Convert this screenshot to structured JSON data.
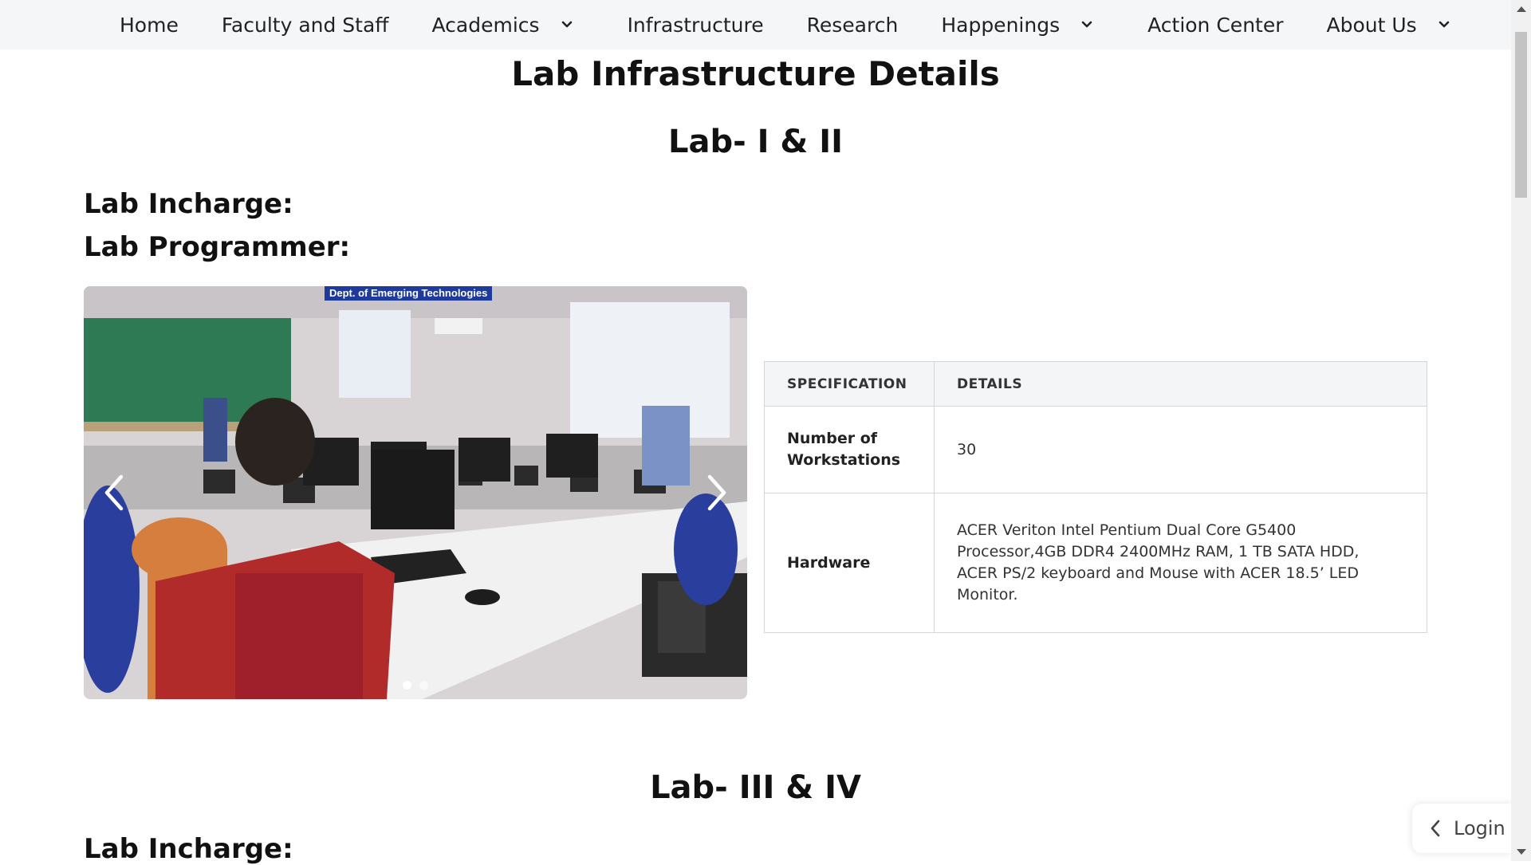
{
  "nav": {
    "items": [
      {
        "label": "Home"
      },
      {
        "label": "Faculty and Staff"
      },
      {
        "label": "Academics"
      },
      {
        "label": "Infrastructure"
      },
      {
        "label": "Research"
      },
      {
        "label": "Happenings"
      },
      {
        "label": "Action Center"
      },
      {
        "label": "About Us"
      }
    ],
    "dropdown_icon": "chevron-down-icon"
  },
  "page_title": "Lab Infrastructure Details",
  "labs": [
    {
      "title": "Lab- I & II",
      "incharge_label": "Lab Incharge:",
      "programmer_label": "Lab Programmer:",
      "carousel": {
        "banner_text": "Dept. of Emerging Technologies",
        "slide_count": 2,
        "active_slide": 1,
        "prev_icon": "chevron-left-icon",
        "next_icon": "chevron-right-icon"
      },
      "table": {
        "headers": [
          "SPECIFICATION",
          "DETAILS"
        ],
        "rows": [
          {
            "spec": "Number of Workstations",
            "details": "30"
          },
          {
            "spec": "Hardware",
            "details": "ACER Veriton Intel Pentium Dual Core G5400 Processor,4GB DDR4 2400MHz RAM, 1 TB SATA HDD, ACER PS/2 keyboard and Mouse with ACER 18.5’ LED Monitor."
          }
        ]
      }
    },
    {
      "title": "Lab- III & IV",
      "incharge_label": "Lab Incharge:"
    }
  ],
  "login": {
    "label": "Login",
    "icon": "chevron-left-icon"
  },
  "colors": {
    "nav_bg": "#f5f6f8",
    "table_header_bg": "#f4f5f6",
    "banner_blue": "#1e3a9c"
  }
}
